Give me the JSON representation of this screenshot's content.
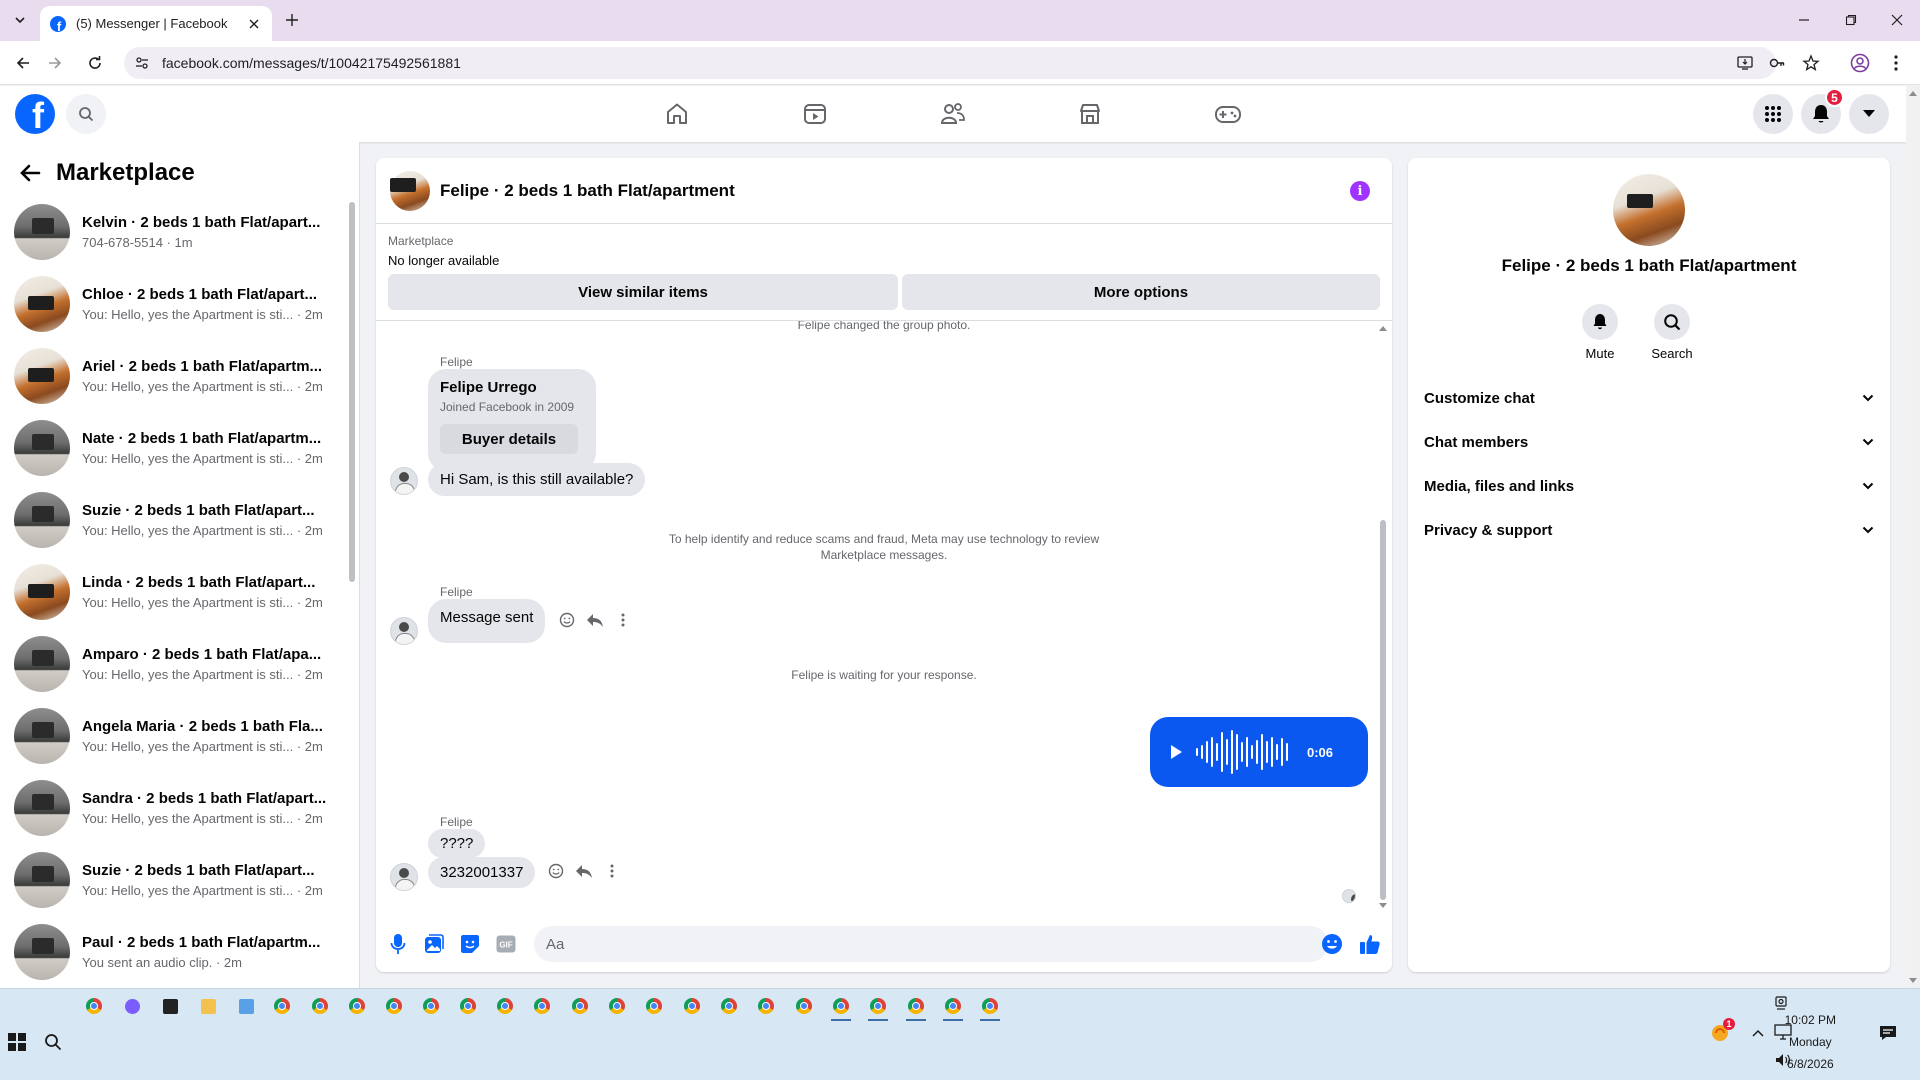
{
  "browser": {
    "tab_title": "(5) Messenger | Facebook",
    "url": "facebook.com/messages/t/10042175492561881"
  },
  "fb_nav": {
    "notification_count": "5",
    "tabs": [
      "home-icon",
      "video-icon",
      "friends-icon",
      "marketplace-icon",
      "gaming-icon"
    ]
  },
  "sidebar": {
    "title": "Marketplace",
    "conversations": [
      {
        "name": "Kelvin · 2 beds 1 bath Flat/apart...",
        "preview": "704-678-5514 · 1m",
        "avatar": "gray"
      },
      {
        "name": "Chloe · 2 beds 1 bath Flat/apart...",
        "preview": "You: Hello, yes the Apartment is sti... · 2m",
        "avatar": "warm"
      },
      {
        "name": "Ariel · 2 beds 1 bath Flat/apartm...",
        "preview": "You: Hello, yes the Apartment is sti... · 2m",
        "avatar": "warm"
      },
      {
        "name": "Nate · 2 beds 1 bath Flat/apartm...",
        "preview": "You: Hello, yes the Apartment is sti... · 2m",
        "avatar": "gray"
      },
      {
        "name": "Suzie · 2 beds 1 bath Flat/apart...",
        "preview": "You: Hello, yes the Apartment is sti... · 2m",
        "avatar": "gray"
      },
      {
        "name": "Linda · 2 beds 1 bath Flat/apart...",
        "preview": "You: Hello, yes the Apartment is sti... · 2m",
        "avatar": "warm"
      },
      {
        "name": "Amparo · 2 beds 1 bath Flat/apa...",
        "preview": "You: Hello, yes the Apartment is sti... · 2m",
        "avatar": "gray"
      },
      {
        "name": "Angela Maria · 2 beds 1 bath Fla...",
        "preview": "You: Hello, yes the Apartment is sti... · 2m",
        "avatar": "gray"
      },
      {
        "name": "Sandra · 2 beds 1 bath Flat/apart...",
        "preview": "You: Hello, yes the Apartment is sti... · 2m",
        "avatar": "gray"
      },
      {
        "name": "Suzie · 2 beds 1 bath Flat/apart...",
        "preview": "You: Hello, yes the Apartment is sti... · 2m",
        "avatar": "gray"
      },
      {
        "name": "Paul · 2 beds 1 bath Flat/apartm...",
        "preview": "You sent an audio clip. · 2m",
        "avatar": "gray"
      }
    ]
  },
  "chat": {
    "title": "Felipe · 2 beds 1 bath Flat/apartment",
    "marketplace_label": "Marketplace",
    "listing_status": "No longer available",
    "view_similar_label": "View similar items",
    "more_options_label": "More options",
    "group_photo_note": "Felipe changed the group photo.",
    "sender_name": "Felipe",
    "profile_card": {
      "name": "Felipe Urrego",
      "joined": "Joined Facebook in 2009",
      "button": "Buyer details"
    },
    "msg_availability": "Hi Sam, is this still available?",
    "scam_notice_line1": "To help identify and reduce scams and fraud, Meta may use technology to review",
    "scam_notice_line2": "Marketplace messages.",
    "msg_sent": "Message sent",
    "waiting_note": "Felipe is waiting for your response.",
    "audio_duration": "0:06",
    "msg_question": "????",
    "msg_number": "3232001337",
    "composer_placeholder": "Aa"
  },
  "info_panel": {
    "title": "Felipe · 2 beds 1 bath Flat/apartment",
    "mute_label": "Mute",
    "search_label": "Search",
    "rows": [
      "Customize chat",
      "Chat members",
      "Media, files and links",
      "Privacy & support"
    ]
  },
  "taskbar": {
    "time": "10:02 PM",
    "day": "Monday",
    "date": "6/8/2026",
    "tray_badge": "1"
  },
  "colors": {
    "fb_blue": "#0866ff",
    "messenger_blue": "#0a58f0",
    "info_purple": "#a033ff",
    "badge_red": "#e41e3f"
  }
}
